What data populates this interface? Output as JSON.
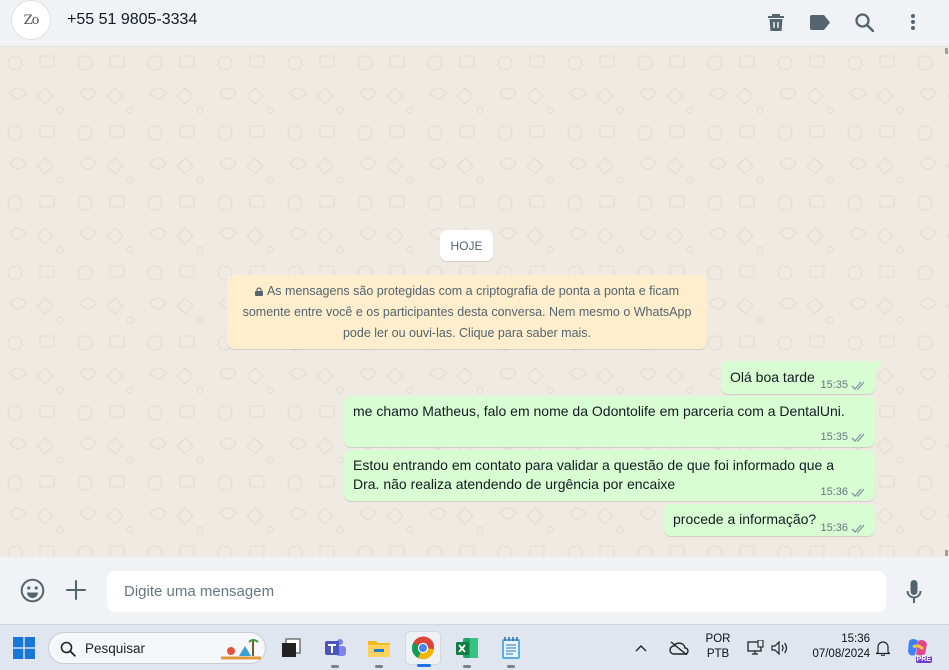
{
  "header": {
    "avatar_text": "Zo",
    "contact_name": "+55 51 9805-3334",
    "icons": [
      "delete-icon",
      "label-icon",
      "search-icon",
      "menu-icon"
    ]
  },
  "chat": {
    "date_label": "HOJE",
    "encryption_notice": [
      "As mensagens são protegidas com a criptografia de ponta a ponta e ficam",
      "somente entre você e os participantes desta conversa. Nem mesmo o WhatsApp",
      "pode ler ou ouvi-las. Clique para saber mais."
    ],
    "messages": [
      {
        "lines": [
          "Olá boa tarde"
        ],
        "time": "15:35"
      },
      {
        "lines": [
          "me chamo Matheus, falo em nome da Odontolife em parceria com a DentalUni."
        ],
        "time": "15:35"
      },
      {
        "lines": [
          "Estou entrando em contato para validar a questão de que foi informado que a",
          "Dra. não realiza atendendo de urgência por encaixe"
        ],
        "time": "15:36"
      },
      {
        "lines": [
          "procede a informação?"
        ],
        "time": "15:36"
      }
    ],
    "colors": {
      "outgoing": "#d9fdd3",
      "notice": "#ffeecd",
      "ticks": "#8696a0"
    }
  },
  "compose": {
    "placeholder": "Digite uma mensagem",
    "icons": [
      "emoji-icon",
      "plus-icon",
      "microphone-icon"
    ]
  },
  "taskbar": {
    "search_label": "Pesquisar",
    "apps": [
      "task-view-icon",
      "teams-icon",
      "file-explorer-icon",
      "chrome-icon",
      "excel-icon",
      "notepad-icon"
    ],
    "lang_top": "POR",
    "lang_bottom": "PTB",
    "time": "15:36",
    "date": "07/08/2024",
    "copilot_badge": "PRE"
  }
}
